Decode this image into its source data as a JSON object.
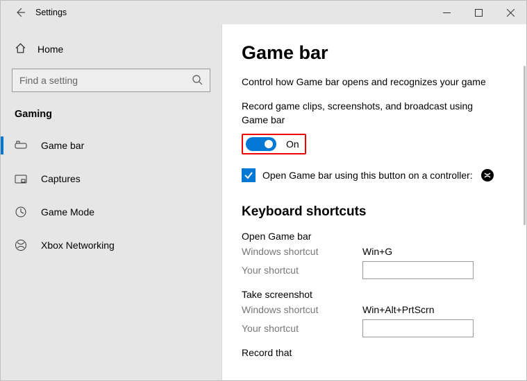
{
  "window": {
    "title": "Settings"
  },
  "sidebar": {
    "home": "Home",
    "search_placeholder": "Find a setting",
    "section": "Gaming",
    "items": [
      {
        "label": "Game bar",
        "icon": "gamebar",
        "active": true
      },
      {
        "label": "Captures",
        "icon": "captures",
        "active": false
      },
      {
        "label": "Game Mode",
        "icon": "gamemode",
        "active": false
      },
      {
        "label": "Xbox Networking",
        "icon": "xbox",
        "active": false
      }
    ]
  },
  "main": {
    "heading": "Game bar",
    "description": "Control how Game bar opens and recognizes your game",
    "record_label": "Record game clips, screenshots, and broadcast using Game bar",
    "toggle_state": "On",
    "controller_label": "Open Game bar using this button on a controller:",
    "shortcuts": {
      "heading": "Keyboard shortcuts",
      "windows_label": "Windows shortcut",
      "your_label": "Your shortcut",
      "groups": [
        {
          "title": "Open Game bar",
          "win": "Win+G",
          "your": ""
        },
        {
          "title": "Take screenshot",
          "win": "Win+Alt+PrtScrn",
          "your": ""
        },
        {
          "title": "Record that",
          "win": "",
          "your": ""
        }
      ]
    }
  }
}
